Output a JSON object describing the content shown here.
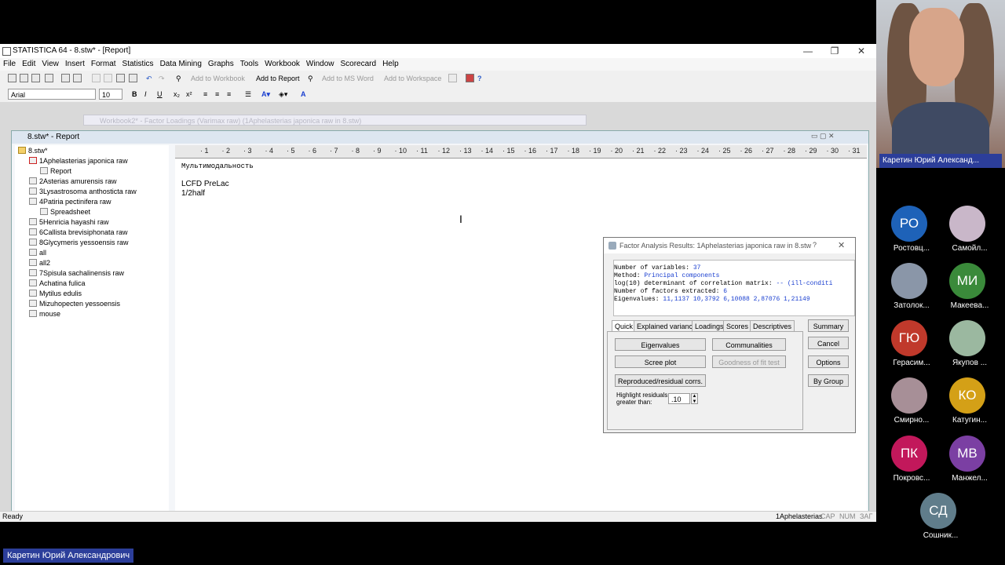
{
  "app": {
    "title": "STATISTICA 64 - 8.stw* - [Report]",
    "menu": [
      "File",
      "Edit",
      "View",
      "Insert",
      "Format",
      "Statistics",
      "Data Mining",
      "Graphs",
      "Tools",
      "Workbook",
      "Window",
      "Scorecard",
      "Help"
    ],
    "toolbar": {
      "add_workbook": "Add to Workbook",
      "add_report": "Add to Report",
      "add_msword": "Add to MS Word",
      "add_workspace": "Add to Workspace"
    },
    "format": {
      "font": "Arial",
      "size": "10"
    },
    "bg_window_title": "Workbook2* - Factor Loadings (Varimax raw) (1Aphelasterias japonica raw in 8.stw)",
    "report_window_title": "8.stw* - Report",
    "tree": {
      "root": "8.stw*",
      "items": [
        "1Aphelasterias japonica raw",
        "Report",
        "2Asterias amurensis raw",
        "3Lysastrosoma anthosticta raw",
        "4Patiria pectinifera raw",
        "Spreadsheet",
        "5Henricia hayashi raw",
        "6Callista brevisiphonata raw",
        "8Glycymeris yessoensis raw",
        "all",
        "all2",
        "7Spisula sachalinensis raw",
        "Achatina fulica",
        "Mytilus edulis",
        "Mizuhopecten yessoensis",
        "mouse"
      ]
    },
    "ruler": [
      "1",
      "2",
      "3",
      "4",
      "5",
      "6",
      "7",
      "8",
      "9",
      "10",
      "11",
      "12",
      "13",
      "14",
      "15",
      "16",
      "17",
      "18",
      "19",
      "20",
      "21",
      "22",
      "23",
      "24",
      "25",
      "26",
      "27",
      "28",
      "29",
      "30",
      "31"
    ],
    "document": {
      "heading": "Мультимодальность",
      "line1": "LCFD PreLac",
      "line2": "1/2half"
    },
    "status": {
      "left": "Ready",
      "sheet": "1Aphelasterias",
      "cap": "CAP",
      "num": "NUM",
      "caf": "ЗАГ"
    }
  },
  "dialog": {
    "title": "Factor Analysis Results: 1Aphelasterias japonica raw in 8.stw",
    "help": "?",
    "lines": [
      {
        "label": "Number of variables:",
        "value": "37"
      },
      {
        "label": "Method:",
        "value": "Principal components"
      },
      {
        "label": "log(10) determinant of correlation matrix:",
        "value": "-- (ill-conditi"
      },
      {
        "label": "Number of factors extracted:",
        "value": "6"
      },
      {
        "label": "Eigenvalues:",
        "value": "11,1137  10,3792  6,10088  2,87076  1,21149"
      }
    ],
    "tabs": [
      "Quick",
      "Explained variance",
      "Loadings",
      "Scores",
      "Descriptives"
    ],
    "buttons": {
      "eigenvalues": "Eigenvalues",
      "communalities": "Communalities",
      "scree": "Scree plot",
      "goodness": "Goodness of fit test",
      "reproduced": "Reproduced/residual corrs.",
      "summary": "Summary",
      "cancel": "Cancel",
      "options": "Options",
      "bygroup": "By Group"
    },
    "highlight_label": "Highlight residuals greater than:",
    "highlight_value": ".10"
  },
  "video": {
    "main_name": "Каретин Юрий Александ...",
    "speaker": "Каретин Юрий Александрович",
    "participants": [
      {
        "initials": "РО",
        "name": "Ростовц...",
        "color": "#1e62b8"
      },
      {
        "initials": "",
        "name": "Самойл...",
        "color": "#c9b7c9"
      },
      {
        "initials": "",
        "name": "Затолок...",
        "color": "#8a96a8"
      },
      {
        "initials": "МИ",
        "name": "Макеева...",
        "color": "#3a8a3a"
      },
      {
        "initials": "ГЮ",
        "name": "Герасим...",
        "color": "#c0392b"
      },
      {
        "initials": "",
        "name": "Якупов ...",
        "color": "#9bb8a0"
      },
      {
        "initials": "",
        "name": "Смирно...",
        "color": "#a78f97"
      },
      {
        "initials": "КО",
        "name": "Катугин...",
        "color": "#d4a017"
      },
      {
        "initials": "ПК",
        "name": "Покровс...",
        "color": "#c2185b"
      },
      {
        "initials": "МВ",
        "name": "Манжел...",
        "color": "#7b3fa3"
      },
      {
        "initials": "СД",
        "name": "Сошник...",
        "color": "#607d8b"
      }
    ]
  }
}
